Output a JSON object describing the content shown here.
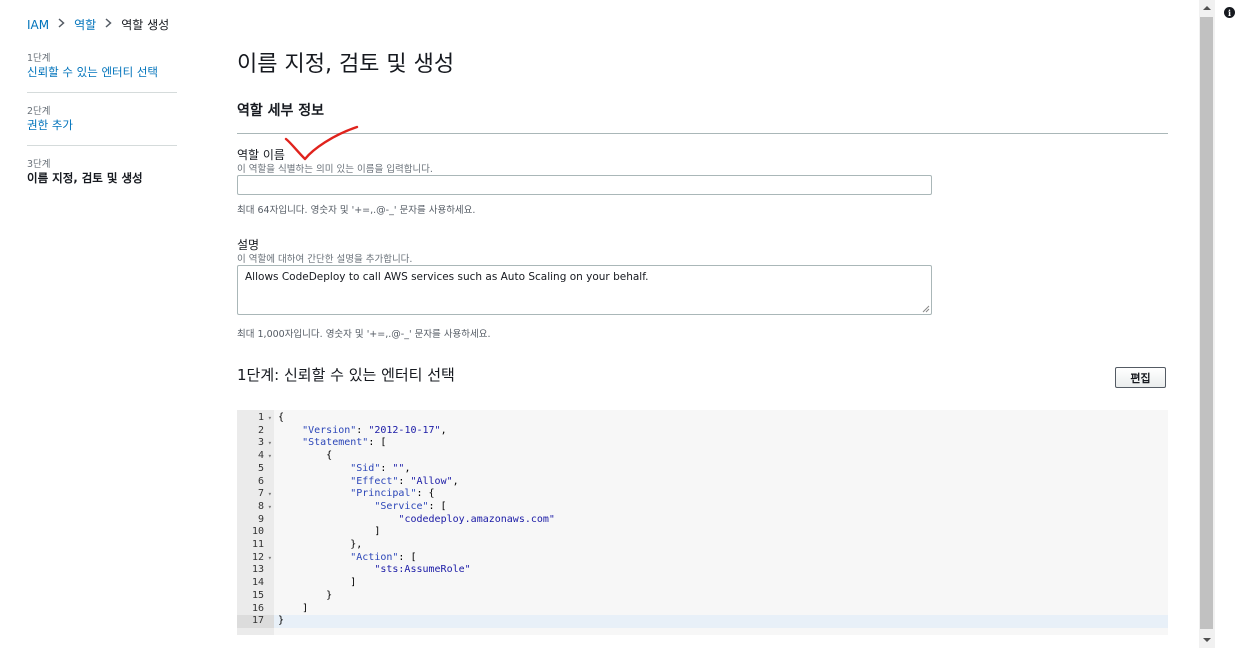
{
  "breadcrumb": {
    "root": "IAM",
    "section": "역할",
    "current": "역할 생성"
  },
  "steps": [
    {
      "num": "1단계",
      "title": "신뢰할 수 있는 엔터티 선택"
    },
    {
      "num": "2단계",
      "title": "권한 추가"
    },
    {
      "num": "3단계",
      "title": "이름 지정, 검토 및 생성"
    }
  ],
  "page_title": "이름 지정, 검토 및 생성",
  "role_details": {
    "header": "역할 세부 정보",
    "name_label": "역할 이름",
    "name_desc": "이 역할을 식별하는 의미 있는 이름을 입력합니다.",
    "name_value": "",
    "name_hint": "최대 64자입니다. 영숫자 및 '+=,.@-_' 문자를 사용하세요.",
    "description_label": "설명",
    "description_desc": "이 역할에 대하여 간단한 설명을 추가합니다.",
    "description_value": "Allows CodeDeploy to call AWS services such as Auto Scaling on your behalf.",
    "description_hint": "최대 1,000자입니다. 영숫자 및 '+=,.@-_' 문자를 사용하세요."
  },
  "trust_section": {
    "title": "1단계: 신뢰할 수 있는 엔터티 선택",
    "edit_label": "편집"
  },
  "policy_lines": [
    "{",
    "    \"Version\": \"2012-10-17\",",
    "    \"Statement\": [",
    "        {",
    "            \"Sid\": \"\",",
    "            \"Effect\": \"Allow\",",
    "            \"Principal\": {",
    "                \"Service\": [",
    "                    \"codedeploy.amazonaws.com\"",
    "                ]",
    "            },",
    "            \"Action\": [",
    "                \"sts:AssumeRole\"",
    "            ]",
    "        }",
    "    ]",
    "}"
  ],
  "line_numbers": [
    "1",
    "2",
    "3",
    "4",
    "5",
    "6",
    "7",
    "8",
    "9",
    "10",
    "11",
    "12",
    "13",
    "14",
    "15",
    "16",
    "17"
  ],
  "fold_lines": [
    1,
    3,
    4,
    7,
    8,
    12
  ],
  "active_line": 17,
  "colors": {
    "link": "#0073bb",
    "text": "#16191f",
    "annotation": "#e0231d"
  }
}
